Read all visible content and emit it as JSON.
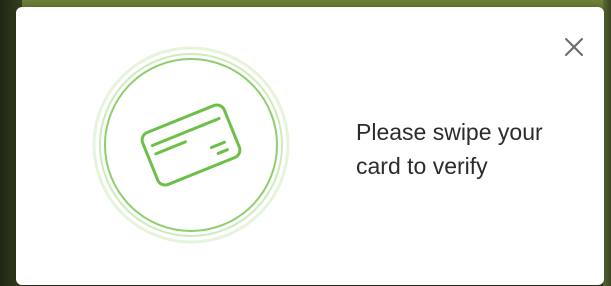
{
  "dialog": {
    "message_lines": [
      "Please swipe your",
      "card to verify"
    ],
    "close_icon": "close-icon",
    "illustration_icon": "credit-card-icon"
  },
  "colors": {
    "accent_green": "#6cc04a",
    "text": "#2b2b2b",
    "close_icon": "#6a6a6a"
  }
}
